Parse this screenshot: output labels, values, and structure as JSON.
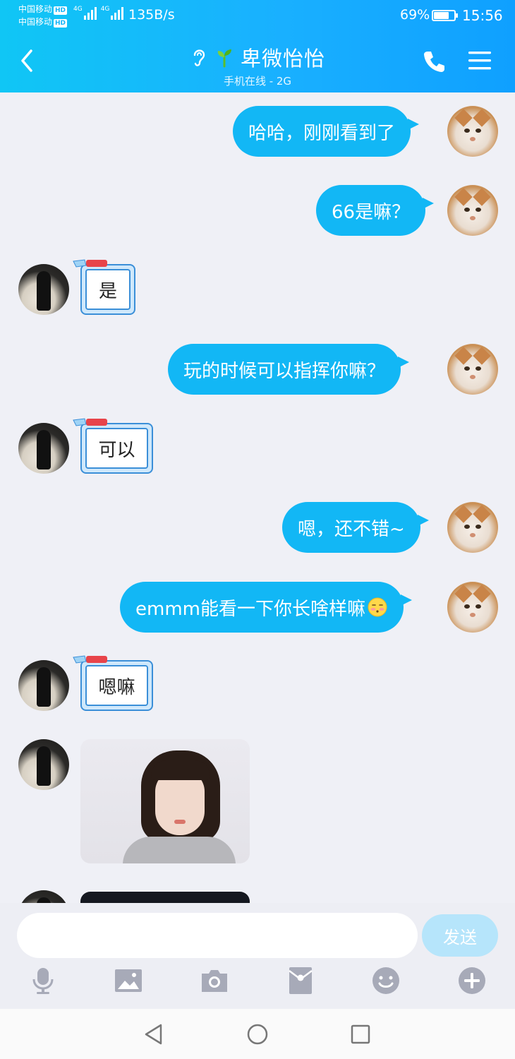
{
  "status": {
    "carrier1": "中国移动",
    "carrier2": "中国移动",
    "hd_badge": "HD",
    "net_type": "4G",
    "net_speed": "135B/s",
    "battery_percent": "69%",
    "battery_level": 0.69,
    "time": "15:56"
  },
  "header": {
    "title": "卑微怡怡",
    "subtitle": "手机在线 - 2G"
  },
  "messages": [
    {
      "side": "out",
      "text": "哈哈，刚刚看到了"
    },
    {
      "side": "out",
      "text": "66是嘛？"
    },
    {
      "side": "in",
      "text": "是"
    },
    {
      "side": "out",
      "text": "玩的时候可以指挥你嘛？"
    },
    {
      "side": "in",
      "text": "可以"
    },
    {
      "side": "out",
      "text": "嗯，还不错~"
    },
    {
      "side": "out",
      "text": "emmm能看一下你长啥样嘛",
      "emoji": "blushing-emoji"
    },
    {
      "side": "in",
      "text": "嗯嘛"
    },
    {
      "side": "in",
      "type": "image",
      "image": "photo-portrait-girl"
    },
    {
      "side": "in",
      "type": "image",
      "image": "photo-dark"
    }
  ],
  "input": {
    "value": "",
    "placeholder": "",
    "send_label": "发送"
  },
  "toolbar": [
    "voice-icon",
    "image-icon",
    "camera-icon",
    "red-packet-icon",
    "emoji-icon",
    "plus-icon"
  ],
  "colors": {
    "accent": "#12b7f5",
    "send_disabled": "#b6e5fb",
    "background": "#eff0f6"
  }
}
